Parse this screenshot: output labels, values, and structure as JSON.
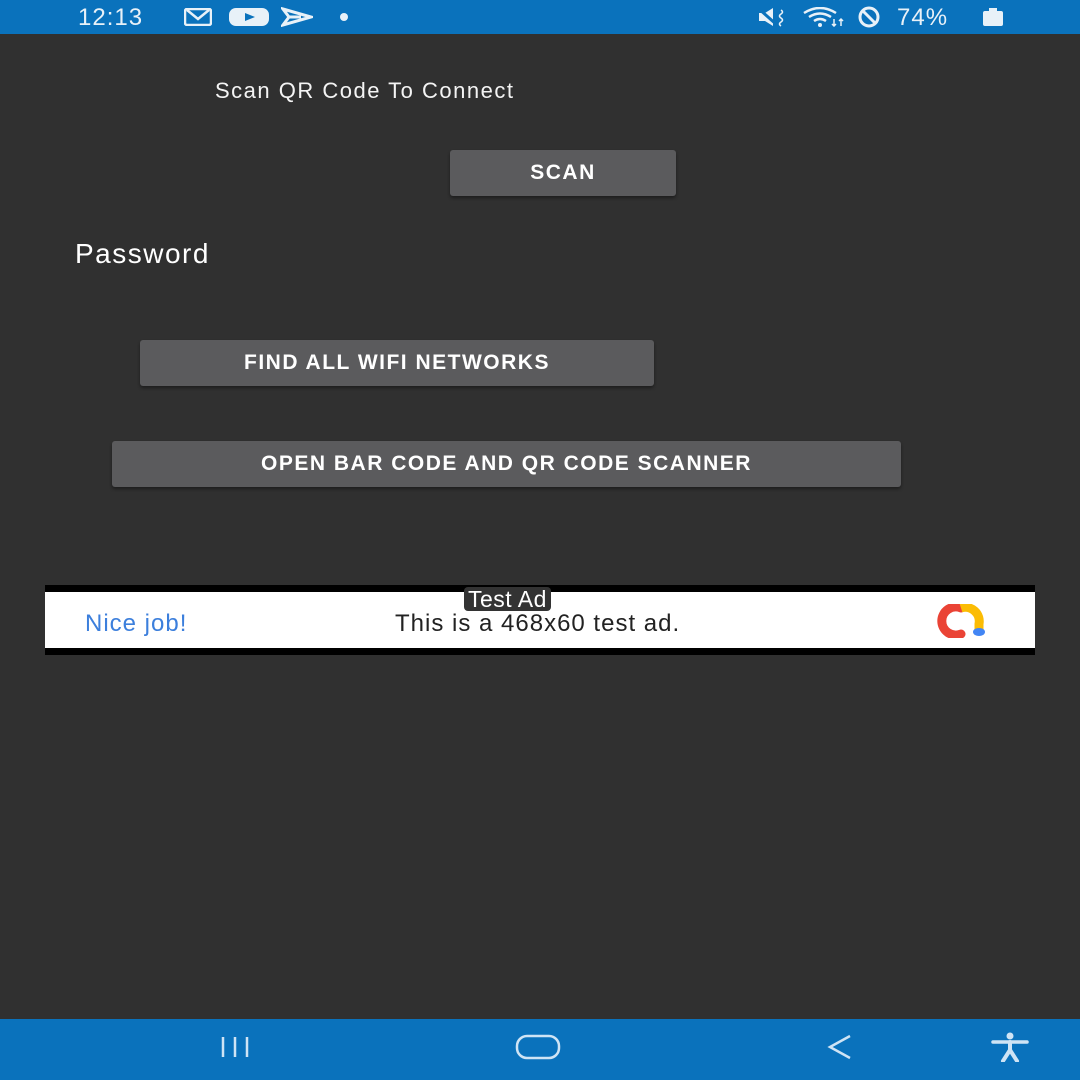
{
  "status_bar": {
    "time": "12:13",
    "left_icons": [
      "gmail-icon",
      "youtube-icon",
      "send-app-icon",
      "notification-dot-icon"
    ],
    "right_icons": [
      "mute-vibrate-icon",
      "wifi-icon",
      "do-not-disturb-icon",
      "battery-icon"
    ],
    "battery_percent": "74%"
  },
  "app": {
    "title": "Scan QR Code To Connect",
    "scan_button": "SCAN",
    "password_label": "Password",
    "find_wifi_button": "FIND ALL WIFI NETWORKS",
    "open_scanner_button": "OPEN BAR CODE AND QR CODE SCANNER"
  },
  "ad": {
    "label": "Test Ad",
    "headline": "Nice job!",
    "body": "This is a 468x60 test ad.",
    "logo_icon": "admob-logo-icon",
    "colors": {
      "headline": "#3c7fdc",
      "logo_red": "#ea4335",
      "logo_yellow": "#fbbc04",
      "logo_blue": "#4285f4"
    }
  },
  "nav_bar": {
    "buttons": [
      "recent-apps",
      "home",
      "back",
      "accessibility"
    ]
  },
  "colors": {
    "status_bar": "#0a72bc",
    "background": "#303030",
    "button": "#5b5b5d"
  }
}
